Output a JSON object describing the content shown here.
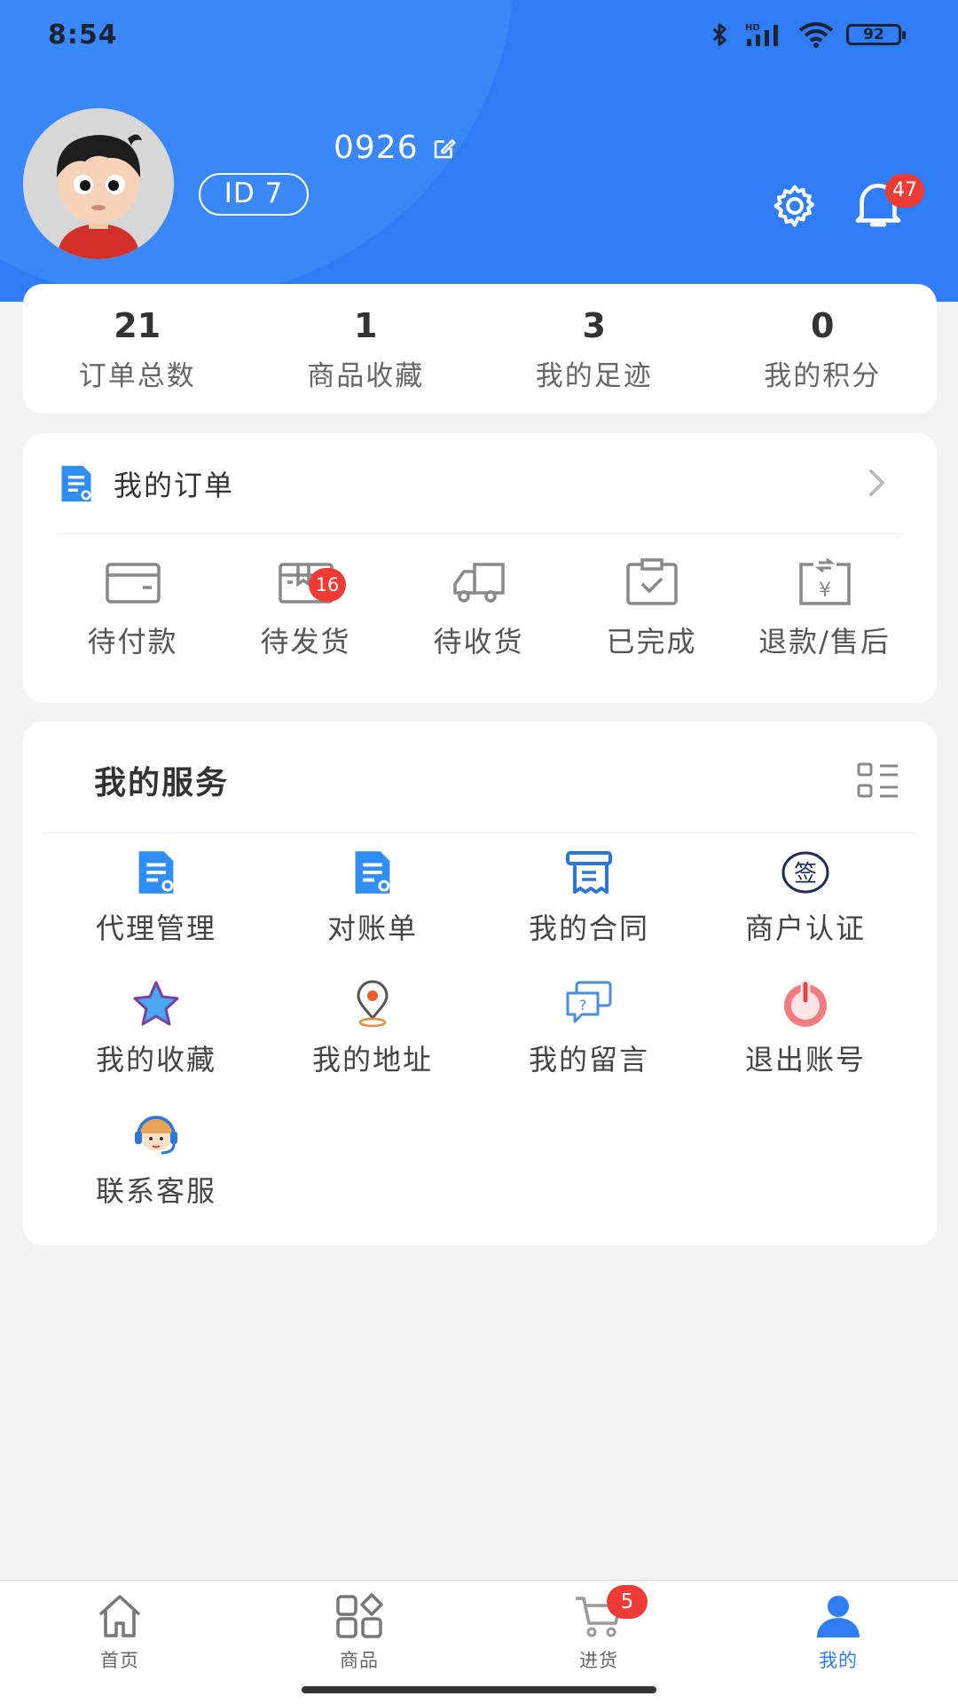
{
  "status_bar": {
    "time": "8:54",
    "battery": "92"
  },
  "profile": {
    "username": "0926",
    "id_label": "ID 7",
    "notification_count": "47"
  },
  "stats": [
    {
      "value": "21",
      "label": "订单总数"
    },
    {
      "value": "1",
      "label": "商品收藏"
    },
    {
      "value": "3",
      "label": "我的足迹"
    },
    {
      "value": "0",
      "label": "我的积分"
    }
  ],
  "orders": {
    "title": "我的订单",
    "items": [
      {
        "label": "待付款",
        "icon": "wallet-icon"
      },
      {
        "label": "待发货",
        "icon": "box-icon",
        "badge": "16"
      },
      {
        "label": "待收货",
        "icon": "truck-icon"
      },
      {
        "label": "已完成",
        "icon": "clipboard-check-icon"
      },
      {
        "label": "退款/售后",
        "icon": "refund-icon"
      }
    ]
  },
  "services": {
    "title": "我的服务",
    "items": [
      {
        "label": "代理管理",
        "icon": "document-user-icon"
      },
      {
        "label": "对账单",
        "icon": "statement-icon"
      },
      {
        "label": "我的合同",
        "icon": "contract-icon"
      },
      {
        "label": "商户认证",
        "icon": "sign-seal-icon",
        "icon_text": "签"
      },
      {
        "label": "我的收藏",
        "icon": "star-icon"
      },
      {
        "label": "我的地址",
        "icon": "location-pin-icon"
      },
      {
        "label": "我的留言",
        "icon": "message-icon"
      },
      {
        "label": "退出账号",
        "icon": "power-icon"
      },
      {
        "label": "联系客服",
        "icon": "customer-service-icon"
      }
    ]
  },
  "bottom_nav": {
    "items": [
      {
        "label": "首页",
        "icon": "home-icon"
      },
      {
        "label": "商品",
        "icon": "grid-icon"
      },
      {
        "label": "进货",
        "icon": "cart-icon",
        "badge": "5"
      },
      {
        "label": "我的",
        "icon": "user-icon",
        "active": true
      }
    ]
  },
  "colors": {
    "brand_blue": "#2f7cf5",
    "badge_red": "#ef3b36",
    "background": "#f3f3f4"
  }
}
